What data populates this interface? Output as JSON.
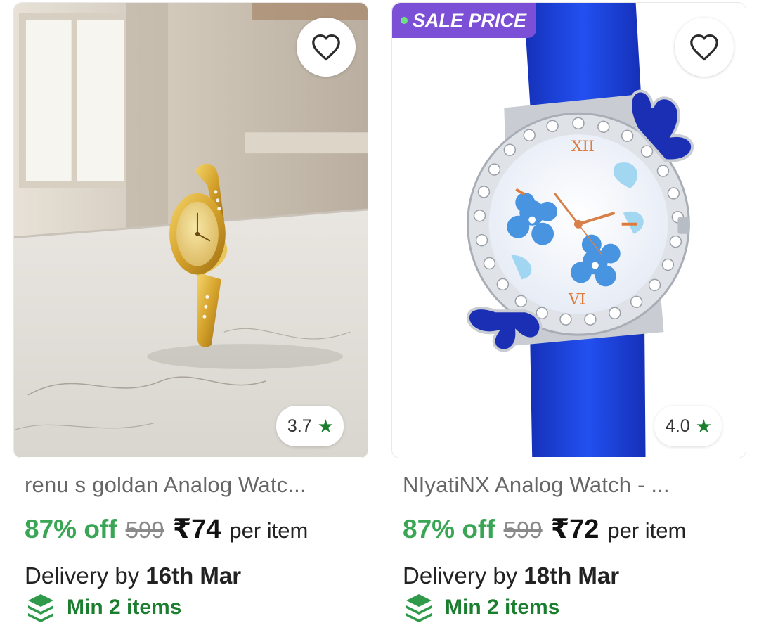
{
  "products": [
    {
      "title": "renu s goldan Analog Watc...",
      "discount": "87% off",
      "mrp": "599",
      "price": "₹74",
      "unit": "per item",
      "delivery_prefix": "Delivery by",
      "delivery_date": "16th Mar",
      "rating": "3.7",
      "min_label": "Min 2 items",
      "image_desc": "gold-bracelet-watch-photo"
    },
    {
      "title": "NIyatiNX Analog Watch  - ...",
      "discount": "87% off",
      "mrp": "599",
      "price": "₹72",
      "unit": "per item",
      "delivery_prefix": "Delivery by",
      "delivery_date": "18th Mar",
      "rating": "4.0",
      "min_label": "Min 2 items",
      "badge": "SALE PRICE",
      "image_desc": "blue-butterfly-watch-photo"
    }
  ],
  "icons": {
    "wishlist": "heart-icon",
    "rating": "star-icon",
    "min_items": "stack-icon"
  },
  "colors": {
    "discount_green": "#3aa655",
    "rating_star": "#1a7e2e",
    "sale_badge": "#7b4fd6",
    "strap_blue": "#1c3fd8",
    "gold": "#d4a12a"
  }
}
